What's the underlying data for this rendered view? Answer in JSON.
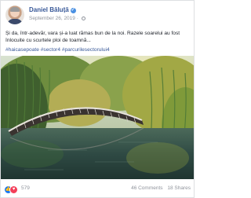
{
  "post": {
    "author": "Daniel Băluță",
    "date": "September 26, 2019",
    "caption": "Și da, într-adevăr, vara și-a luat rămas bun de la noi. Razele soarelui au fost înlocuite cu scurtele ploi de toamnă...",
    "hashtags": "#haicasepoate #sector4 #parcurilesectorului4",
    "reactions_count": "579",
    "comments": "46 Comments",
    "shares": "18 Shares"
  },
  "icons": {
    "verified": "verified-badge-icon",
    "privacy": "globe-icon",
    "like": "like-reaction-icon",
    "love": "love-reaction-icon"
  },
  "colors": {
    "link": "#385898",
    "like": "#1877f2",
    "love": "#f33e58"
  }
}
